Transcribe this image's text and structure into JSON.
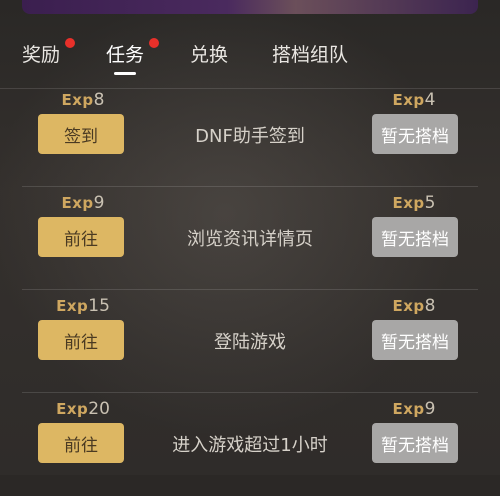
{
  "tabs": [
    {
      "label": "奖励",
      "badge": true
    },
    {
      "label": "任务",
      "badge": true,
      "active": true
    },
    {
      "label": "兑换",
      "badge": false
    },
    {
      "label": "搭档组队",
      "badge": false
    }
  ],
  "exp_tag": "Exp",
  "tasks": [
    {
      "exp_left": "8",
      "button": "签到",
      "title": "DNF助手签到",
      "exp_right": "4",
      "partner_button": "暂无搭档"
    },
    {
      "exp_left": "9",
      "button": "前往",
      "title": "浏览资讯详情页",
      "exp_right": "5",
      "partner_button": "暂无搭档"
    },
    {
      "exp_left": "15",
      "button": "前往",
      "title": "登陆游戏",
      "exp_right": "8",
      "partner_button": "暂无搭档"
    },
    {
      "exp_left": "20",
      "button": "前往",
      "title": "进入游戏超过1小时",
      "exp_right": "9",
      "partner_button": "暂无搭档"
    }
  ],
  "colors": {
    "accent_gold": "#ddb763",
    "badge_red": "#e8302a",
    "disabled_gray": "#a8a7a6"
  }
}
